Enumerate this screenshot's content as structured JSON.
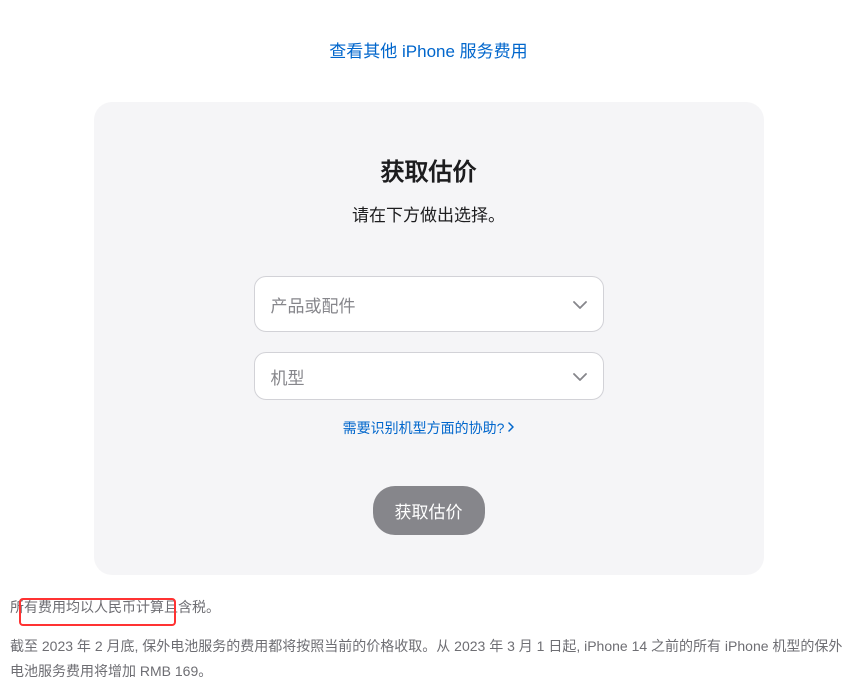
{
  "header": {
    "link_text": "查看其他 iPhone 服务费用"
  },
  "card": {
    "title": "获取估价",
    "subtitle": "请在下方做出选择。",
    "select1_placeholder": "产品或配件",
    "select2_placeholder": "机型",
    "help_link_text": "需要识别机型方面的协助?",
    "submit_button_label": "获取估价"
  },
  "footer": {
    "line1": "所有费用均以人民币计算且含税。",
    "line2": "截至 2023 年 2 月底, 保外电池服务的费用都将按照当前的价格收取。从 2023 年 3 月 1 日起, iPhone 14 之前的所有 iPhone 机型的保外电池服务费用将增加 RMB 169。"
  }
}
